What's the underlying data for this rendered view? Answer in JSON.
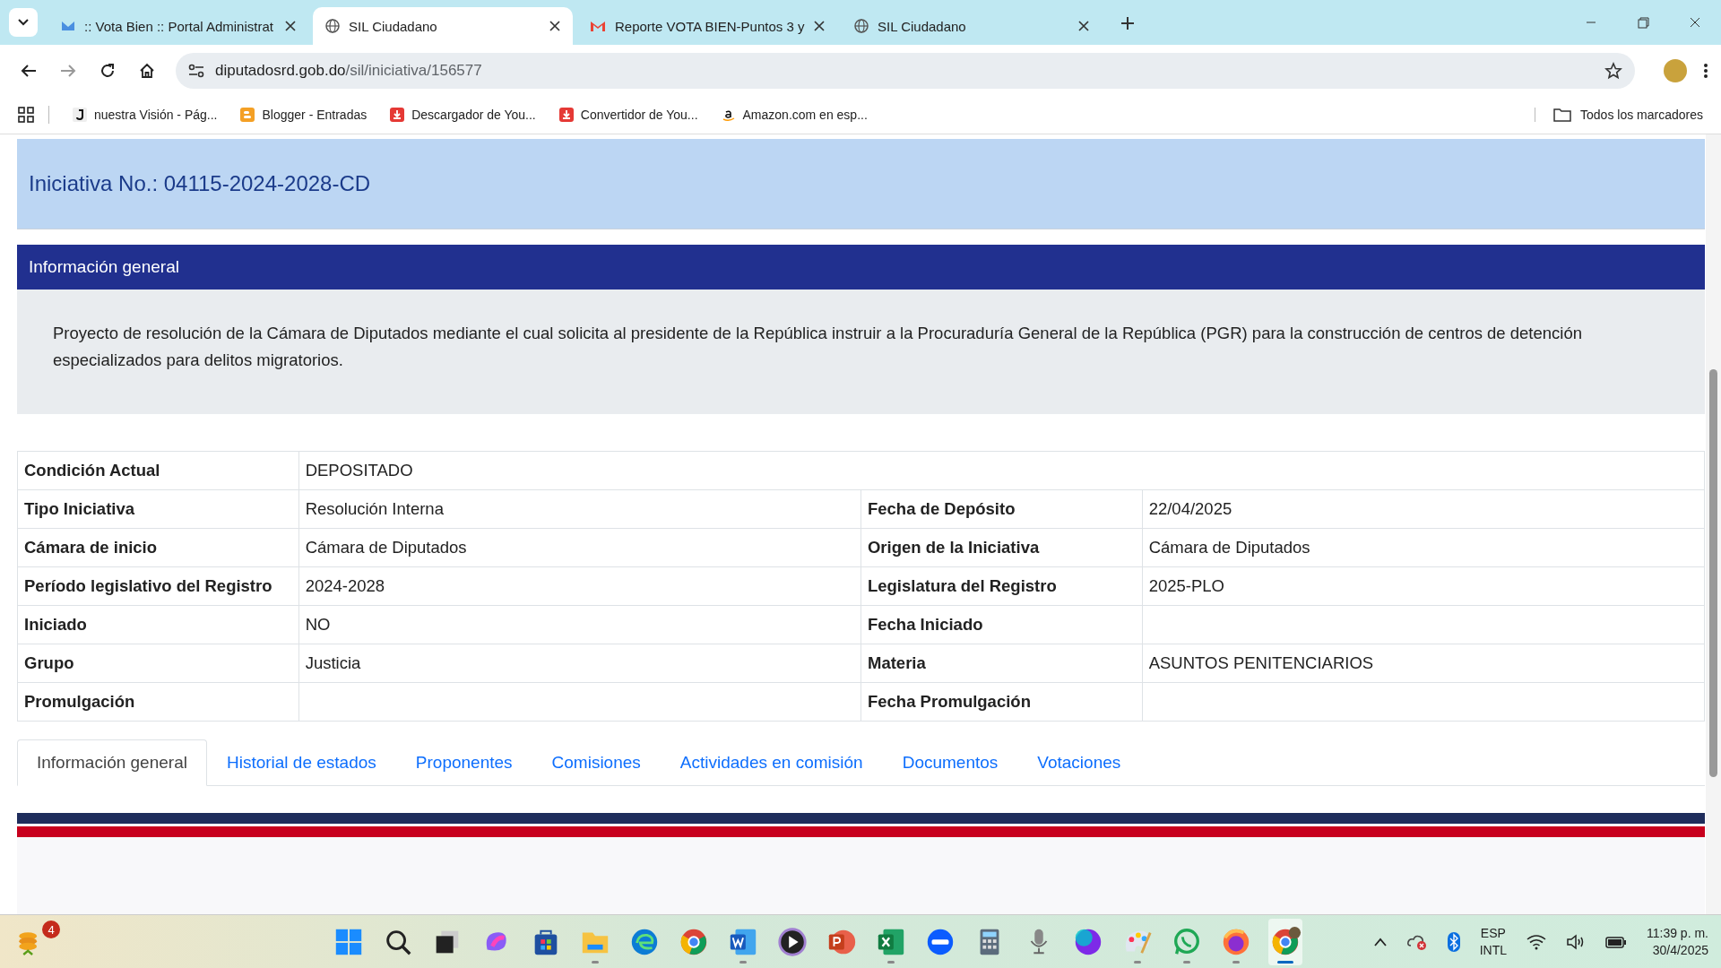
{
  "browser_tabs": [
    {
      "title": ":: Vota Bien :: Portal Administrat",
      "kind": "mail",
      "selected": false
    },
    {
      "title": "SIL Ciudadano",
      "kind": "globe",
      "selected": true
    },
    {
      "title": "Reporte VOTA BIEN-Puntos 3 y",
      "kind": "gmail",
      "selected": false
    },
    {
      "title": "SIL Ciudadano",
      "kind": "globe",
      "selected": false
    }
  ],
  "address_bar": {
    "domain": "diputadosrd.gob.do",
    "path": "/sil/iniciativa/156577"
  },
  "bookmarks": [
    {
      "label": "nuestra Visión - Pág...",
      "kind": "j"
    },
    {
      "label": "Blogger - Entradas",
      "kind": "blogger"
    },
    {
      "label": "Descargador de You...",
      "kind": "download"
    },
    {
      "label": "Convertidor de You...",
      "kind": "download"
    },
    {
      "label": "Amazon.com en esp...",
      "kind": "amazon"
    }
  ],
  "all_bookmarks": "Todos los marcadores",
  "page": {
    "title": "Iniciativa No.: 04115-2024-2028-CD",
    "section_title": "Información general",
    "description": "Proyecto de resolución de la Cámara de Diputados mediante el cual solicita al presidente de la República instruir a la Procuraduría General de la República (PGR) para la construcción de centros de detención especializados para delitos migratorios.",
    "details": [
      [
        {
          "label": "Condición Actual",
          "value": "DEPOSITADO"
        }
      ],
      [
        {
          "label": "Tipo Iniciativa",
          "value": "Resolución Interna"
        },
        {
          "label": "Fecha de Depósito",
          "value": "22/04/2025"
        }
      ],
      [
        {
          "label": "Cámara de inicio",
          "value": "Cámara de Diputados"
        },
        {
          "label": "Origen de la Iniciativa",
          "value": "Cámara de Diputados"
        }
      ],
      [
        {
          "label": "Período legislativo del Registro",
          "value": "2024-2028"
        },
        {
          "label": "Legislatura del Registro",
          "value": "2025-PLO"
        }
      ],
      [
        {
          "label": "Iniciado",
          "value": "NO"
        },
        {
          "label": "Fecha Iniciado"
        }
      ],
      [
        {
          "label": "Grupo",
          "value": "Justicia"
        },
        {
          "label": "Materia",
          "value": "ASUNTOS PENITENCIARIOS"
        }
      ],
      [
        {
          "label": "Promulgación"
        },
        {
          "label": "Fecha Promulgación"
        }
      ]
    ],
    "tabs": [
      {
        "label": "Información general",
        "selected": true
      },
      {
        "label": "Historial de estados",
        "selected": false
      },
      {
        "label": "Proponentes",
        "selected": false
      },
      {
        "label": "Comisiones",
        "selected": false
      },
      {
        "label": "Actividades en comisión",
        "selected": false
      },
      {
        "label": "Documentos",
        "selected": false
      },
      {
        "label": "Votaciones",
        "selected": false
      }
    ]
  },
  "taskbar": {
    "badge": "4",
    "apps": [
      {
        "running": false
      },
      {
        "running": false
      },
      {
        "running": false
      },
      {
        "running": false
      },
      {
        "running": false
      },
      {
        "running": true
      },
      {
        "running": false
      },
      {
        "running": false
      },
      {
        "running": true
      },
      {
        "running": false
      },
      {
        "running": false
      },
      {
        "running": true
      },
      {
        "running": false
      },
      {
        "running": false
      },
      {
        "running": false
      },
      {
        "running": false
      },
      {
        "running": true
      },
      {
        "running": true
      },
      {
        "running": true
      },
      {
        "running": true,
        "selected": true
      }
    ],
    "language": "ESP",
    "layout": "INTL",
    "time": "11:39 p. m.",
    "date": "30/4/2025"
  }
}
